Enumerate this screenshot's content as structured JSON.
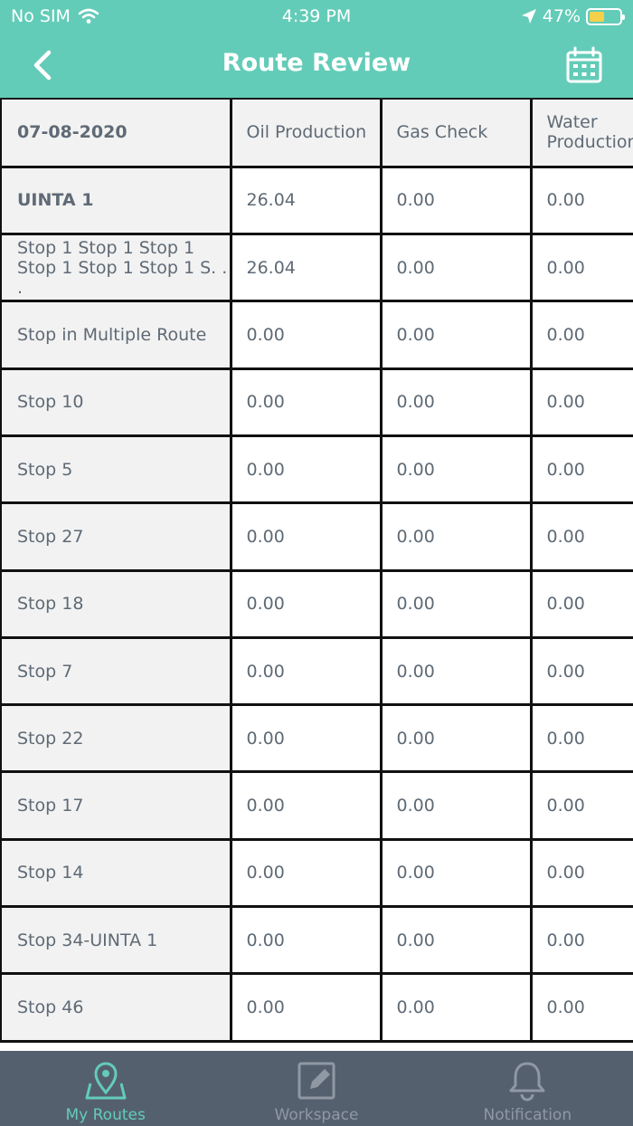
{
  "status": {
    "carrier": "No SIM",
    "time": "4:39 PM",
    "battery": "47%",
    "battery_level": 0.47
  },
  "header": {
    "title": "Route Review"
  },
  "table": {
    "headers": [
      "07-08-2020",
      "Oil Production",
      "Gas Check",
      "Water Production"
    ],
    "rows": [
      {
        "name": "UINTA 1",
        "values": [
          "26.04",
          "0.00",
          "0.00"
        ]
      },
      {
        "name": "Stop 1 Stop 1 Stop 1 Stop 1 Stop 1 Stop 1 S. . .",
        "values": [
          "26.04",
          "0.00",
          "0.00"
        ]
      },
      {
        "name": "Stop in Multiple Route",
        "values": [
          "0.00",
          "0.00",
          "0.00"
        ]
      },
      {
        "name": "Stop 10",
        "values": [
          "0.00",
          "0.00",
          "0.00"
        ]
      },
      {
        "name": "Stop 5",
        "values": [
          "0.00",
          "0.00",
          "0.00"
        ]
      },
      {
        "name": "Stop 27",
        "values": [
          "0.00",
          "0.00",
          "0.00"
        ]
      },
      {
        "name": "Stop 18",
        "values": [
          "0.00",
          "0.00",
          "0.00"
        ]
      },
      {
        "name": "Stop 7",
        "values": [
          "0.00",
          "0.00",
          "0.00"
        ]
      },
      {
        "name": "Stop 22",
        "values": [
          "0.00",
          "0.00",
          "0.00"
        ]
      },
      {
        "name": "Stop 17",
        "values": [
          "0.00",
          "0.00",
          "0.00"
        ]
      },
      {
        "name": "Stop 14",
        "values": [
          "0.00",
          "0.00",
          "0.00"
        ]
      },
      {
        "name": "Stop 34-UINTA 1",
        "values": [
          "0.00",
          "0.00",
          "0.00"
        ]
      },
      {
        "name": "Stop 46",
        "values": [
          "0.00",
          "0.00",
          "0.00"
        ]
      }
    ]
  },
  "tabbar": {
    "tabs": [
      "My Routes",
      "Workspace",
      "Notification"
    ]
  },
  "colors": {
    "accent": "#63ccb8",
    "tabbar": "#55606f",
    "row_header": "#f2f2f2"
  }
}
